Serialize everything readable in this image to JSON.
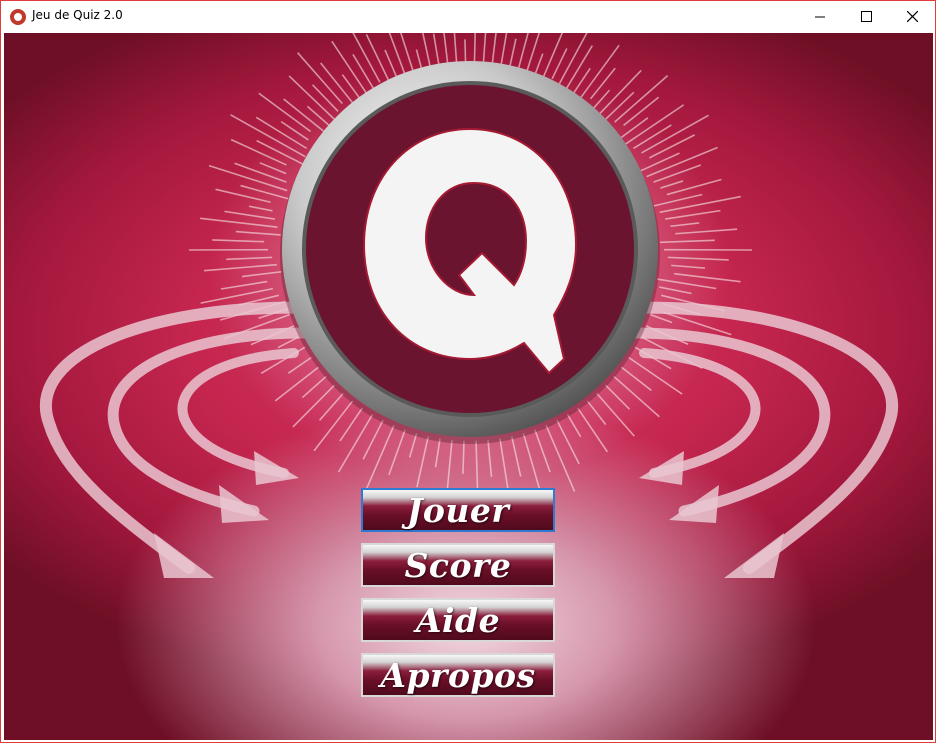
{
  "window": {
    "title": "Jeu de Quiz 2.0",
    "icon": "quiz-app-icon",
    "controls": [
      "minimize-icon",
      "maximize-icon",
      "close-icon"
    ]
  },
  "logo": {
    "letter": "Q",
    "colors": {
      "ring": "#b9b9b9",
      "disc": "#6b1430",
      "glyph": "#f4f4f4"
    }
  },
  "menu": {
    "buttons": [
      {
        "label": "Jouer",
        "focused": true
      },
      {
        "label": "Score"
      },
      {
        "label": "Aide"
      },
      {
        "label": "Apropos"
      }
    ]
  },
  "colors": {
    "background": "#c5264f",
    "background_dark": "#6e0f25",
    "button_top": "#f7f7f7",
    "button_bottom": "#500a1c",
    "focus_border": "#2f7ad1"
  }
}
